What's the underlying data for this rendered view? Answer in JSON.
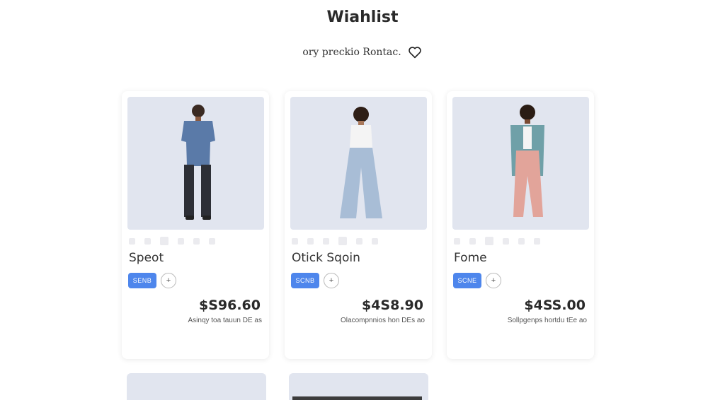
{
  "page": {
    "title": "Wiahlist",
    "subtitle": "ory preckio Rontac."
  },
  "items": [
    {
      "name": "Speot",
      "tag": "SENB",
      "add": "+",
      "price": "$S96.60",
      "note": "Asinqy toa tauun DE as"
    },
    {
      "name": "Otick Sqoin",
      "tag": "SCNB",
      "add": "+",
      "price": "$4S8.90",
      "note": "Olacompnnios hon DEs ao"
    },
    {
      "name": "Fome",
      "tag": "SCNE",
      "add": "+",
      "price": "$4SS.00",
      "note": "Sollpgenps hortdu tEe ao"
    }
  ],
  "colors": {
    "accent": "#4e86ec",
    "photo_bg": "#e1e5ef"
  },
  "icons": {
    "heart": "heart-icon"
  }
}
